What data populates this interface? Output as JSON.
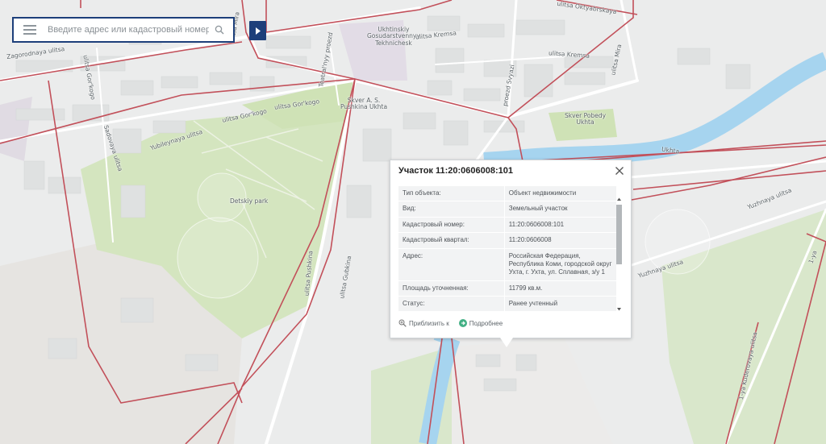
{
  "search": {
    "placeholder": "Введите адрес или кадастровый номер",
    "menu_icon": "hamburger-menu-icon",
    "search_icon": "magnifier-icon",
    "toggle_icon": "play-triangle-icon"
  },
  "colors": {
    "accent": "#1d3f7a",
    "boundary": "#c2505a",
    "river": "#a3d3ee",
    "park": "#cfe3b8",
    "link_green": "#43b085"
  },
  "map_labels": {
    "ulitsa_oktyabrskaya": "ulitsa Oktyabrskaya",
    "zagorodnaya": "Zagorodnaya ulitsa",
    "ulitsa_gorkogo_1": "ulitsa Gor'kogo",
    "ulitsa_gorkogo_2": "ulitsa Gor'kogo",
    "ulitsa_gorkogo_3": "ulitsa Gor'kogo",
    "teatralnyy": "Teatral'nyy proezd",
    "university": "Ukhtinskiy\nGosudarstvennyy\nTekhnichesk",
    "ulitsa_kremsa_1": "ulitsa Kremsa",
    "ulitsa_kremsa_2": "ulitsa Kremsa",
    "ulitsa_mira": "ulitsa Mira",
    "ulitsa_mira_2": "ulitsa Mira",
    "skver_pushkina": "Skver A. S.\nPushkina Ukhta",
    "skver_pobedy": "Skver Pobedy\nUkhta",
    "proezd_svyazi": "proezd Svyazi",
    "ukhta_river": "Ukhta",
    "yuzhnaya": "Yuzhnaya ulitsa",
    "yuzhnaya_2": "Yuzhnaya ulitsa",
    "ulitsa_gubkina": "ulitsa Gubkina",
    "ulitsa_pushkina": "ulitsa Pushkina",
    "detskiy_park": "Detskiy park",
    "yuhileynaya": "Yubileynaya ulitsa",
    "sadovaya": "Sadovaya ulitsa",
    "kuderovaya": "1-ya Kuderovaya ulitsa",
    "ulitsa_1": "1-ya"
  },
  "popup": {
    "title": "Участок 11:20:0606008:101",
    "close_icon": "close-x-icon",
    "rows": [
      {
        "key": "Тип объекта:",
        "value": "Объект недвижимости"
      },
      {
        "key": "Вид:",
        "value": "Земельный участок"
      },
      {
        "key": "Кадастровый номер:",
        "value": "11:20:0606008:101"
      },
      {
        "key": "Кадастровый квартал:",
        "value": "11:20:0606008"
      },
      {
        "key": "Адрес:",
        "value": "Российская Федерация, Республика Коми, городской округ Ухта, г. Ухта, ул. Сплавная, з/у 1"
      },
      {
        "key": "Площадь уточненная:",
        "value": "11799 кв.м."
      },
      {
        "key": "Статус:",
        "value": "Ранее учтенный"
      }
    ],
    "actions": {
      "zoom_label": "Приблизить к",
      "zoom_icon": "zoom-in-magnifier-icon",
      "details_label": "Подробнее",
      "details_icon": "arrow-right-circle-icon"
    }
  }
}
